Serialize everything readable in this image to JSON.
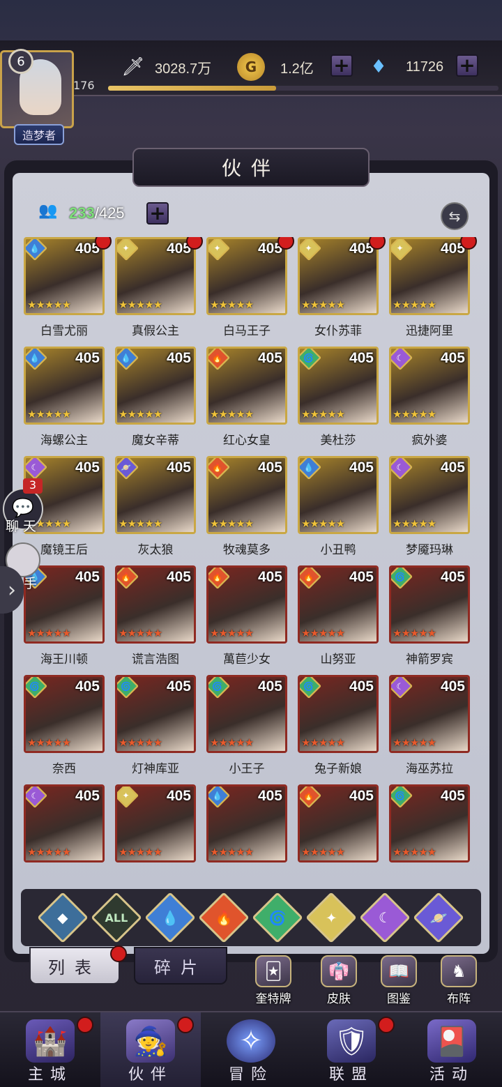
{
  "player": {
    "level": "6",
    "exp_level_text": "176",
    "exp_progress": 0.43,
    "title": "造梦者"
  },
  "resources": {
    "power": "3028.7万",
    "gold": "1.2亿",
    "diamonds": "11726"
  },
  "panel": {
    "title": "伙伴",
    "count_current": "233",
    "count_total": "/425"
  },
  "heroes": [
    {
      "name": "白雪尤丽",
      "level": "405",
      "tier": "gold",
      "element": "water",
      "dot": true
    },
    {
      "name": "真假公主",
      "level": "405",
      "tier": "gold",
      "element": "light",
      "dot": true
    },
    {
      "name": "白马王子",
      "level": "405",
      "tier": "gold",
      "element": "light",
      "dot": true
    },
    {
      "name": "女仆苏菲",
      "level": "405",
      "tier": "gold",
      "element": "light",
      "dot": true
    },
    {
      "name": "迅捷阿里",
      "level": "405",
      "tier": "gold",
      "element": "light",
      "dot": true
    },
    {
      "name": "海螺公主",
      "level": "405",
      "tier": "gold",
      "element": "water",
      "dot": false
    },
    {
      "name": "魔女辛蒂",
      "level": "405",
      "tier": "gold",
      "element": "water",
      "dot": false
    },
    {
      "name": "红心女皇",
      "level": "405",
      "tier": "gold",
      "element": "fire",
      "dot": false
    },
    {
      "name": "美杜莎",
      "level": "405",
      "tier": "gold",
      "element": "wind",
      "dot": false
    },
    {
      "name": "疯外婆",
      "level": "405",
      "tier": "gold",
      "element": "dark",
      "dot": false
    },
    {
      "name": "魔镜王后",
      "level": "405",
      "tier": "gold",
      "element": "dark",
      "dot": false
    },
    {
      "name": "灰太狼",
      "level": "405",
      "tier": "gold",
      "element": "cosmic",
      "dot": false
    },
    {
      "name": "牧魂莫多",
      "level": "405",
      "tier": "gold",
      "element": "fire",
      "dot": false
    },
    {
      "name": "小丑鸭",
      "level": "405",
      "tier": "gold",
      "element": "water",
      "dot": false
    },
    {
      "name": "梦魇玛琳",
      "level": "405",
      "tier": "gold",
      "element": "dark",
      "dot": false
    },
    {
      "name": "海王川顿",
      "level": "405",
      "tier": "red",
      "element": "water",
      "dot": false
    },
    {
      "name": "谎言浩图",
      "level": "405",
      "tier": "red",
      "element": "fire",
      "dot": false
    },
    {
      "name": "萬苣少女",
      "level": "405",
      "tier": "red",
      "element": "fire",
      "dot": false
    },
    {
      "name": "山努亚",
      "level": "405",
      "tier": "red",
      "element": "fire",
      "dot": false
    },
    {
      "name": "神箭罗宾",
      "level": "405",
      "tier": "red",
      "element": "wind",
      "dot": false
    },
    {
      "name": "奈西",
      "level": "405",
      "tier": "red",
      "element": "wind",
      "dot": false
    },
    {
      "name": "灯神库亚",
      "level": "405",
      "tier": "red",
      "element": "wind",
      "dot": false
    },
    {
      "name": "小王子",
      "level": "405",
      "tier": "red",
      "element": "wind",
      "dot": false
    },
    {
      "name": "兔子新娘",
      "level": "405",
      "tier": "red",
      "element": "wind",
      "dot": false
    },
    {
      "name": "海巫苏拉",
      "level": "405",
      "tier": "red",
      "element": "dark",
      "dot": false
    },
    {
      "name": "",
      "level": "405",
      "tier": "red",
      "element": "dark",
      "dot": false
    },
    {
      "name": "",
      "level": "405",
      "tier": "red",
      "element": "light",
      "dot": false
    },
    {
      "name": "",
      "level": "405",
      "tier": "red",
      "element": "water",
      "dot": false
    },
    {
      "name": "",
      "level": "405",
      "tier": "red",
      "element": "fire",
      "dot": false
    },
    {
      "name": "",
      "level": "405",
      "tier": "red",
      "element": "wind",
      "dot": false
    }
  ],
  "filters": [
    "back",
    "ALL",
    "water",
    "fire",
    "wind",
    "light",
    "dark",
    "cosmic"
  ],
  "filter_all_label": "ALL",
  "tabs": {
    "list": "列表",
    "fragments": "碎片"
  },
  "shortcuts": {
    "tarot": "奎特牌",
    "skins": "皮肤",
    "codex": "图鉴",
    "formation": "布阵"
  },
  "side": {
    "chat_label": "聊天",
    "chat_count": "3",
    "helper_label": "手"
  },
  "nav": {
    "main_city": "主城",
    "partners": "伙伴",
    "adventure": "冒险",
    "alliance": "联盟",
    "events": "活动"
  },
  "colors": {
    "water": "#3f7fd6",
    "fire": "#e0542c",
    "wind": "#3fae6a",
    "light": "#d8c25a",
    "dark": "#9a5ad6",
    "cosmic": "#6a5ad6",
    "gold_border": "#c9a744",
    "red_border": "#8f2a22"
  }
}
